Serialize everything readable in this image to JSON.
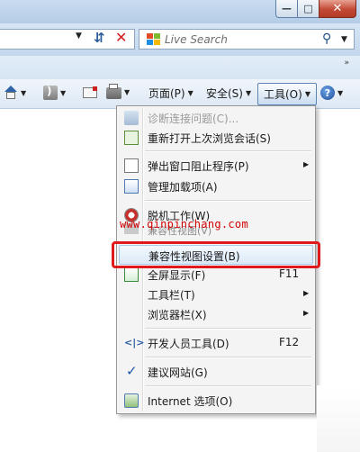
{
  "address_bar": {
    "search_placeholder": "Live Search"
  },
  "toolbar": {
    "page_label": "页面(P)",
    "safety_label": "安全(S)",
    "tools_label": "工具(O)"
  },
  "menu": {
    "items": [
      {
        "label": "诊断连接问题(C)...",
        "disabled": true
      },
      {
        "label": "重新打开上次浏览会话(S)"
      },
      {
        "label": "弹出窗口阻止程序(P)",
        "submenu": true
      },
      {
        "label": "管理加载项(A)"
      },
      {
        "label": "脱机工作(W)"
      },
      {
        "label": "兼容性视图(V)"
      },
      {
        "label": "兼容性视图设置(B)",
        "highlighted": true
      },
      {
        "label": "全屏显示(F)",
        "shortcut": "F11"
      },
      {
        "label": "工具栏(T)",
        "submenu": true
      },
      {
        "label": "浏览器栏(X)",
        "submenu": true
      },
      {
        "label": "开发人员工具(D)",
        "shortcut": "F12"
      },
      {
        "label": "建议网站(G)",
        "checked": true
      },
      {
        "label": "Internet 选项(O)"
      }
    ]
  },
  "watermark": "www.qinpinchang.com",
  "colors": {
    "highlight_border": "#e0191d",
    "watermark": "#d40000"
  }
}
